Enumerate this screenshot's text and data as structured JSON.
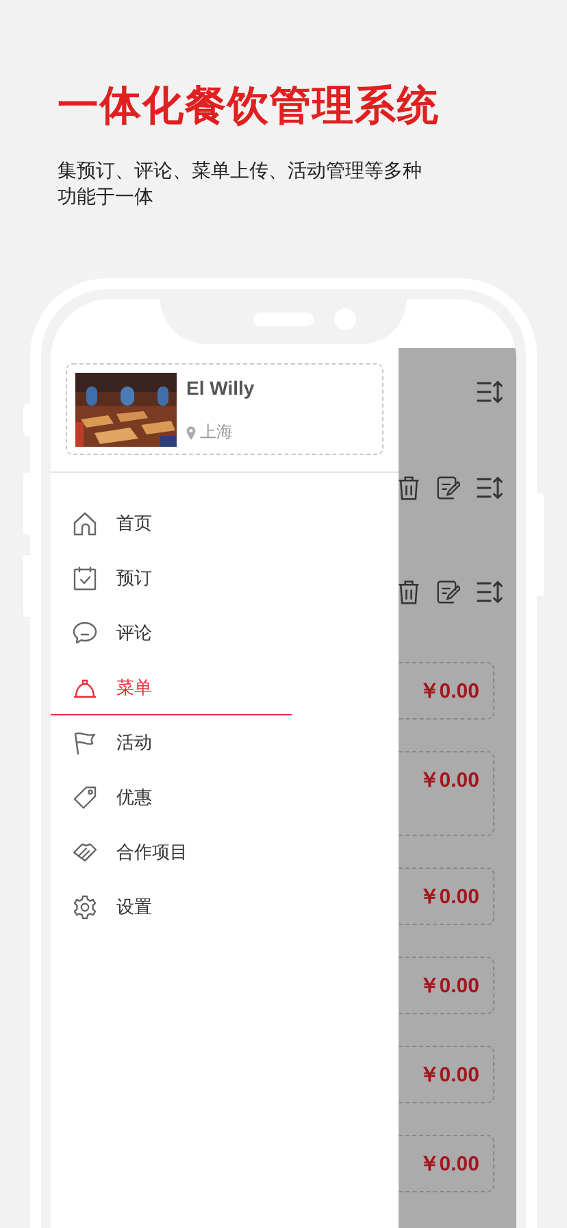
{
  "header": {
    "title": "一体化餐饮管理系统",
    "subtitle": "集预订、评论、菜单上传、活动管理等多种功能于一体"
  },
  "restaurant": {
    "name": "El Willy",
    "location": "上海"
  },
  "menu": [
    {
      "label": "首页",
      "kind": "home",
      "selected": false
    },
    {
      "label": "预订",
      "kind": "calendar",
      "selected": false
    },
    {
      "label": "评论",
      "kind": "comment",
      "selected": false
    },
    {
      "label": "菜单",
      "kind": "cloche",
      "selected": true
    },
    {
      "label": "活动",
      "kind": "flag",
      "selected": false
    },
    {
      "label": "优惠",
      "kind": "tag",
      "selected": false
    },
    {
      "label": "合作项目",
      "kind": "handshake",
      "selected": false
    },
    {
      "label": "设置",
      "kind": "gear",
      "selected": false
    }
  ],
  "action_rows": [
    {
      "kind": "sort"
    },
    {
      "kind": "full"
    },
    {
      "kind": "full"
    }
  ],
  "prices": [
    {
      "price": "￥0.00",
      "kind": "short"
    },
    {
      "price": "￥0.00",
      "kind": "tall"
    },
    {
      "price": "￥0.00",
      "kind": "short"
    },
    {
      "price": "￥0.00",
      "kind": "short"
    },
    {
      "price": "￥0.00",
      "kind": "short"
    },
    {
      "price": "￥0.00",
      "kind": "short"
    }
  ]
}
